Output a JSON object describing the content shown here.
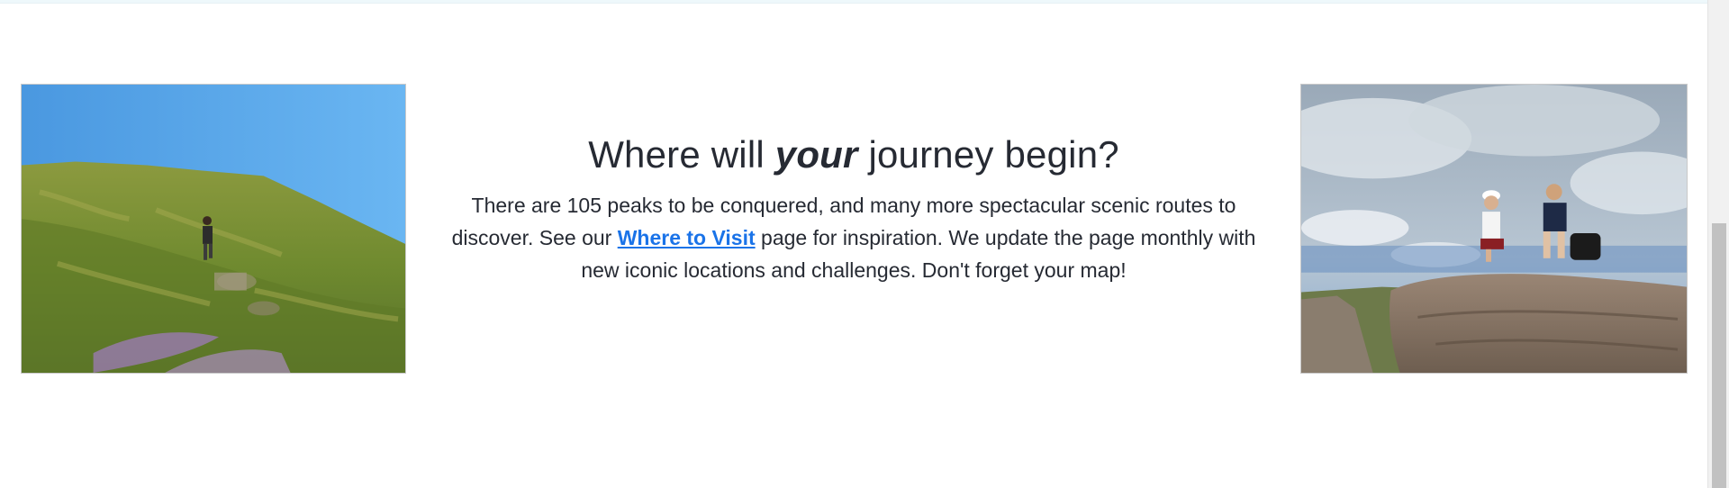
{
  "section": {
    "heading_before": "Where will ",
    "heading_emphasis": "your",
    "heading_after": " journey begin?",
    "body_before": "There are 105 peaks to be conquered, and many more spectacular scenic routes to discover. See our ",
    "body_link": "Where to Visit",
    "body_after": " page for inspiration. We update the page monthly with new iconic locations and challenges. Don't forget your map!"
  },
  "images": {
    "left": "hiker-on-hillside-photo",
    "right": "two-hikers-on-rock-photo"
  },
  "colors": {
    "text": "#262a33",
    "link": "#1a73e8",
    "background": "#ffffff"
  }
}
